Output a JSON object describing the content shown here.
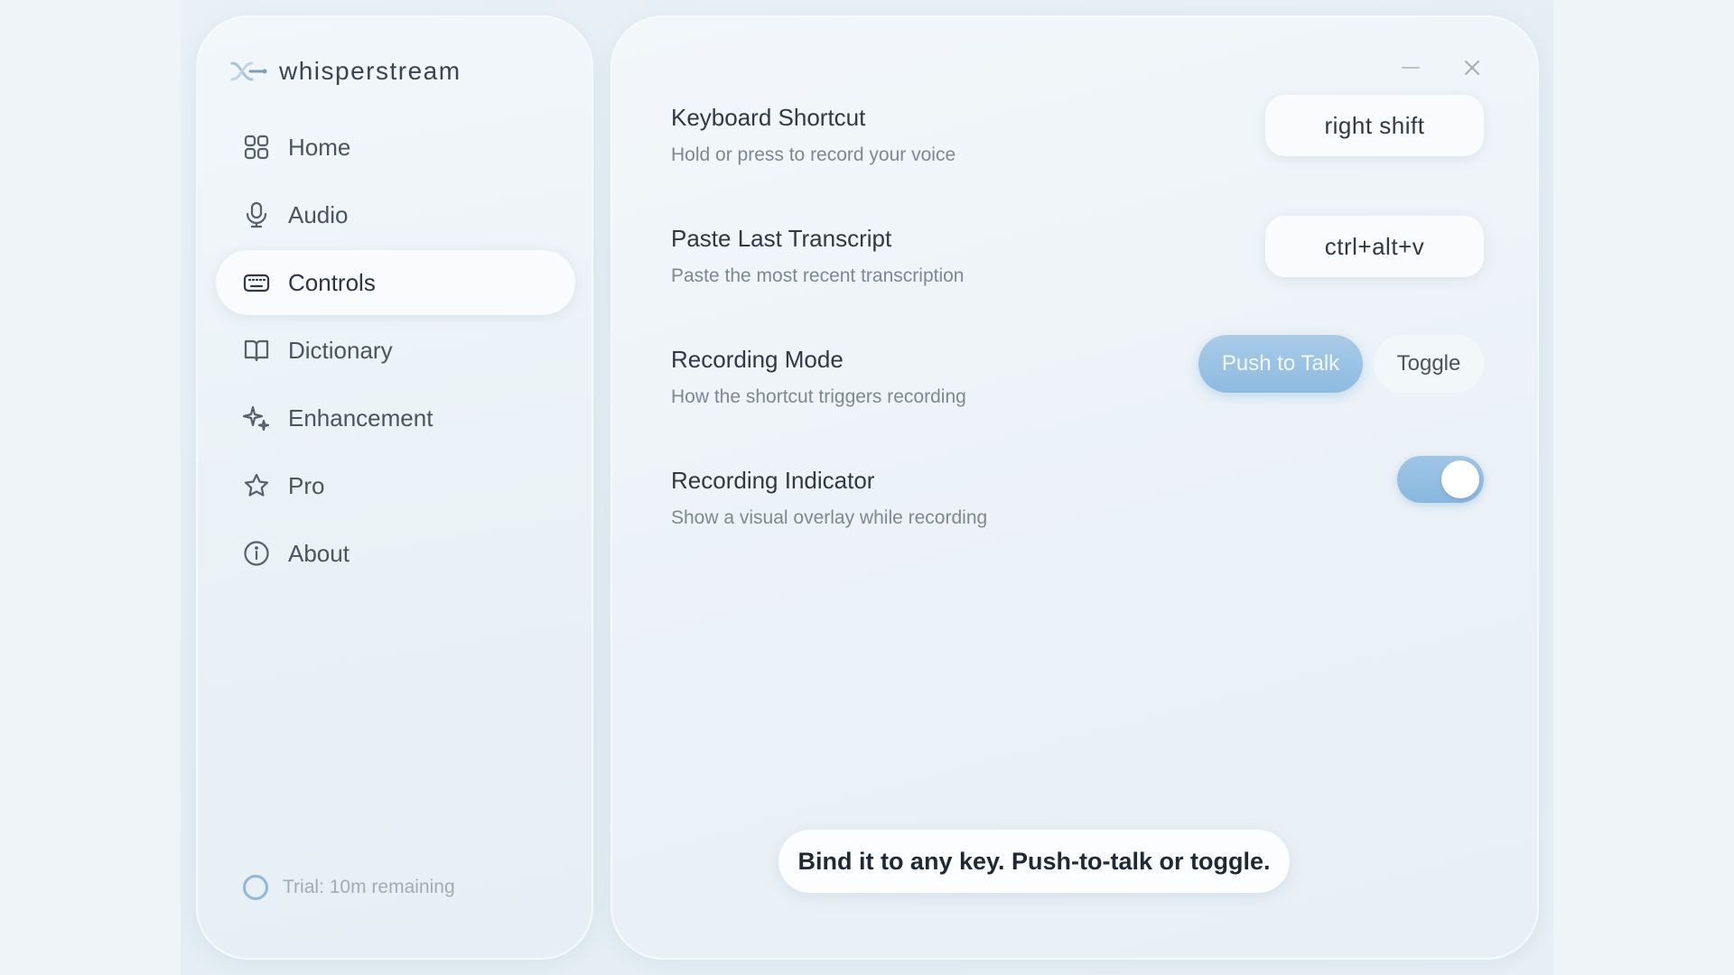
{
  "app": {
    "name": "whisperstream",
    "accent": "#8dbbe0"
  },
  "sidebar": {
    "items": [
      {
        "label": "Home",
        "icon": "grid-icon",
        "active": false
      },
      {
        "label": "Audio",
        "icon": "microphone-icon",
        "active": false
      },
      {
        "label": "Controls",
        "icon": "keyboard-icon",
        "active": true
      },
      {
        "label": "Dictionary",
        "icon": "book-icon",
        "active": false
      },
      {
        "label": "Enhancement",
        "icon": "sparkles-icon",
        "active": false
      },
      {
        "label": "Pro",
        "icon": "star-icon",
        "active": false
      },
      {
        "label": "About",
        "icon": "info-icon",
        "active": false
      }
    ],
    "trial_text": "Trial: 10m remaining"
  },
  "settings": {
    "keyboard_shortcut": {
      "title": "Keyboard Shortcut",
      "description": "Hold or press to record your voice",
      "value": "right shift"
    },
    "paste_last": {
      "title": "Paste Last Transcript",
      "description": "Paste the most recent transcription",
      "value": "ctrl+alt+v"
    },
    "recording_mode": {
      "title": "Recording Mode",
      "description": "How the shortcut triggers recording",
      "options": [
        "Push to Talk",
        "Toggle"
      ],
      "selected": "Push to Talk"
    },
    "recording_indicator": {
      "title": "Recording Indicator",
      "description": "Show a visual overlay while recording",
      "enabled": true
    }
  },
  "caption": "Bind it to any key. Push-to-talk or toggle."
}
